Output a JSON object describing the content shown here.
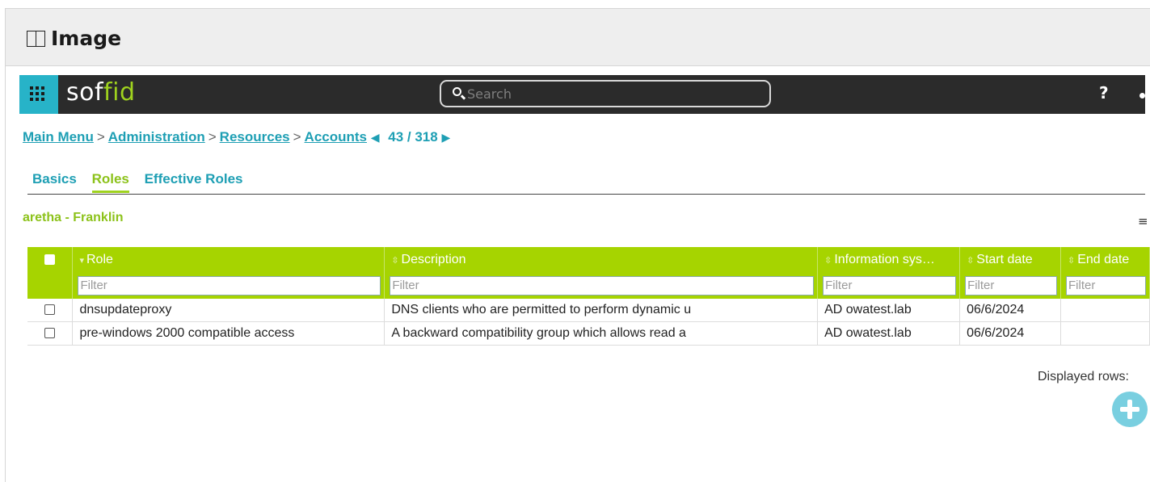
{
  "panel": {
    "title": "Image"
  },
  "topbar": {
    "logo_main": "sof",
    "logo_accent": "fid",
    "search_placeholder": "Search",
    "help_label": "?"
  },
  "breadcrumb": {
    "items": [
      "Main Menu",
      "Administration",
      "Resources",
      "Accounts"
    ],
    "separator": ">",
    "pager": "43 / 318"
  },
  "tabs": [
    {
      "label": "Basics",
      "active": false
    },
    {
      "label": "Roles",
      "active": true
    },
    {
      "label": "Effective Roles",
      "active": false
    }
  ],
  "account_name": "aretha - Franklin",
  "table": {
    "columns": [
      {
        "label": "Role",
        "sort": "desc"
      },
      {
        "label": "Description",
        "sort": "none"
      },
      {
        "label": "Information sys…",
        "sort": "none"
      },
      {
        "label": "Start date",
        "sort": "none"
      },
      {
        "label": "End date",
        "sort": "none"
      }
    ],
    "filter_placeholder": "Filter",
    "rows": [
      {
        "role": "dnsupdateproxy",
        "description": "DNS clients who are permitted to perform dynamic u",
        "system": "AD owatest.lab",
        "start": "06/6/2024",
        "end": ""
      },
      {
        "role": "pre-windows 2000 compatible access",
        "description": "A backward compatibility group which allows read a",
        "system": "AD owatest.lab",
        "start": "06/6/2024",
        "end": ""
      }
    ]
  },
  "footer": {
    "displayed_rows_label": "Displayed rows:"
  },
  "colors": {
    "accent_green": "#a6d400",
    "accent_teal": "#1e9fb4",
    "topbar": "#2b2b2b"
  }
}
